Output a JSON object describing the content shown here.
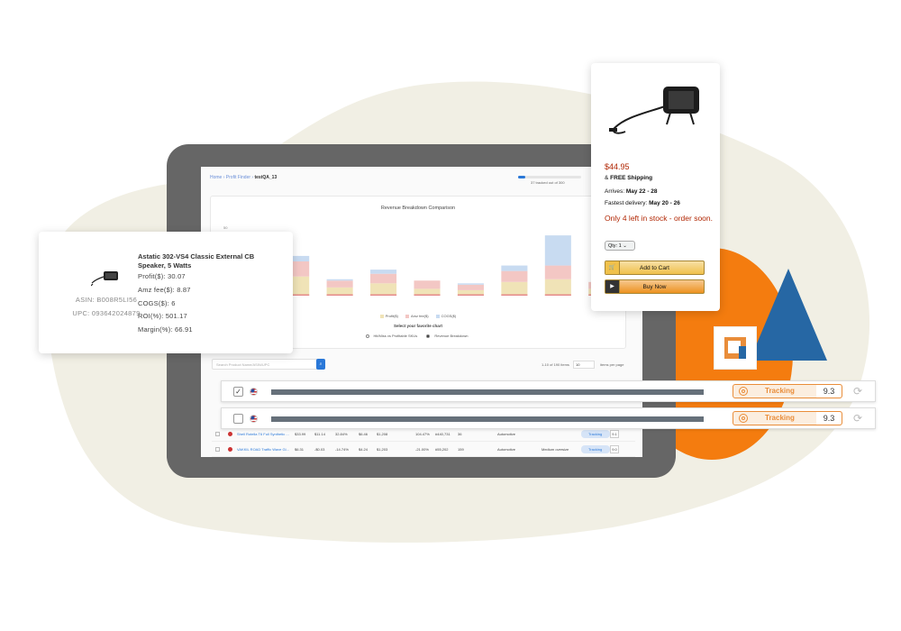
{
  "tablet": {
    "breadcrumb": {
      "home": "Home",
      "section": "Profit Finder",
      "current": "testQA_13"
    },
    "progress": {
      "label": "37 tracked out of 300",
      "fraction": 0.12
    },
    "chart_data": {
      "type": "bar",
      "title": "Revenue Breakdown Comparison",
      "y_tick": "50",
      "categories": [
        "P1",
        "P2",
        "P3",
        "P4",
        "P5",
        "P6",
        "P7",
        "P8",
        "P9"
      ],
      "series": [
        {
          "name": "Profit($)",
          "color": "#f0e3b7",
          "values": [
            8,
            14,
            6,
            9,
            5,
            4,
            10,
            12,
            5
          ]
        },
        {
          "name": "Amz fee($)",
          "color": "#f3c7c4",
          "values": [
            6,
            11,
            5,
            7,
            6,
            4,
            8,
            10,
            5
          ]
        },
        {
          "name": "COGS($)",
          "color": "#c8dbf1",
          "values": [
            0,
            4,
            1,
            3,
            0,
            1,
            4,
            22,
            0
          ]
        }
      ],
      "ylim": [
        0,
        50
      ],
      "legend_position": "bottom"
    },
    "chart_prompt": "Select your favorite chart",
    "chart_options": [
      {
        "label": "Hit/Miss vs Profitable SKUs",
        "selected": false
      },
      {
        "label": "Revenue Breakdown",
        "selected": true
      }
    ],
    "search_placeholder": "Search Product Name/ASIN/UPC",
    "pager_text": "1-10 of 190 items",
    "pager_select": "10",
    "pager_label": "items per page",
    "rows": [
      {
        "name": "Shell Rotella T6 Full Synthetic ...",
        "price": "$33.99",
        "profit": "$11.14",
        "margin": "32.84%",
        "fee": "$6.46",
        "sales": "$1,208",
        "roi": "104.47%",
        "bsr": "#440,731",
        "count": "36",
        "category": "Automotive",
        "size": "",
        "track": "Tracking",
        "score": "9.1"
      },
      {
        "name": "VAKKIL ROAD Traffic Wave Gl...",
        "price": "$6.31",
        "profit": "-$0.03",
        "margin": "-14.74%",
        "fee": "$4.24",
        "sales": "$1,203",
        "roi": "-21.00%",
        "bsr": "#55,202",
        "count": "159",
        "category": "Automotive",
        "size": "Medium oversize",
        "track": "Tracking",
        "score": "9.0"
      }
    ]
  },
  "product_card": {
    "title": "Astatic 302-VS4 Classic External CB Speaker, 5 Watts",
    "asin": "ASIN: B008R5LI56",
    "upc": "UPC: 093642024879",
    "profit": "Profit($): 30.07",
    "amz_fee": "Amz fee($): 8.87",
    "cogs": "COGS($): 6",
    "roi": "ROI(%): 501.17",
    "margin": "Margin(%): 66.91"
  },
  "amazon_card": {
    "price": "$44.95",
    "shipping_prefix": "& ",
    "shipping": "FREE Shipping",
    "arrives_label": "Arrives: ",
    "arrives": "May 22 - 28",
    "fastest_label": "Fastest delivery: ",
    "fastest": "May 20 - 26",
    "stock": "Only 4 left in stock - order soon.",
    "qty": "Qty: 1",
    "add_to_cart": "Add to Cart",
    "buy_now": "Buy Now"
  },
  "tracking_rows": [
    {
      "checked": true,
      "check_mark": "✓",
      "status": "Tracking",
      "score": "9.3"
    },
    {
      "checked": false,
      "check_mark": "",
      "status": "Tracking",
      "score": "9.3"
    }
  ],
  "colors": {
    "orange": "#f47c0f",
    "blue": "#2667a4",
    "blob": "#f1efe4",
    "tablet": "#666666",
    "accent": "#e98d3a"
  }
}
